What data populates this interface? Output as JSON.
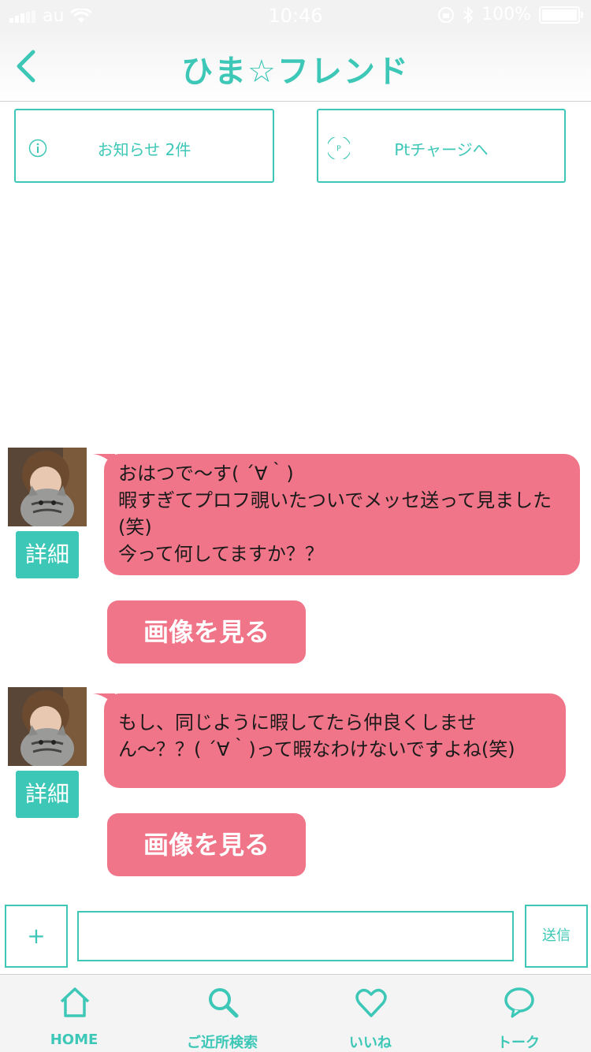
{
  "status_bar": {
    "carrier": "au",
    "time": "10:46",
    "battery": "100%"
  },
  "header": {
    "title": "ひま☆フレンド"
  },
  "top_buttons": {
    "notice_label": "お知らせ 2件",
    "charge_label": "Ptチャージへ",
    "charge_icon_letter": "P"
  },
  "messages": [
    {
      "text": "おはつで〜す( ´∀｀)\n暇すぎてプロフ覗いたついでメッセ送って見ました(笑)\n今って何してますか？？",
      "detail_label": "詳細",
      "image_button_label": "画像を見る"
    },
    {
      "text": "もし、同じように暇してたら仲良くしません〜？？( ´∀｀)って暇なわけないですよね(笑)",
      "detail_label": "詳細",
      "image_button_label": "画像を見る"
    }
  ],
  "composer": {
    "plus_label": "+",
    "input_value": "",
    "send_label": "送信"
  },
  "tabs": [
    {
      "label": "HOME",
      "icon": "home-icon"
    },
    {
      "label": "ご近所検索",
      "icon": "search-icon"
    },
    {
      "label": "いいね",
      "icon": "heart-icon"
    },
    {
      "label": "トーク",
      "icon": "speech-bubble-icon"
    }
  ],
  "colors": {
    "accent": "#3cc7b7",
    "bubble": "#f07589"
  }
}
